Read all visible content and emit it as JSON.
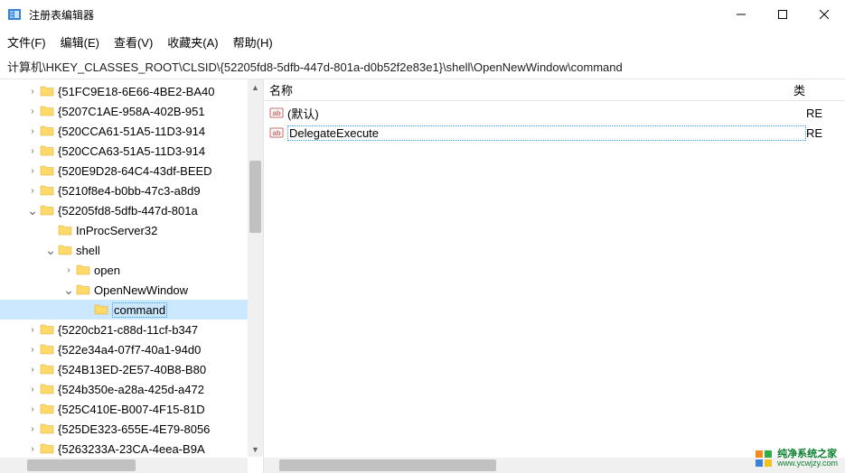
{
  "window": {
    "title": "注册表编辑器"
  },
  "menu": {
    "file": "文件(F)",
    "edit": "编辑(E)",
    "view": "查看(V)",
    "favorites": "收藏夹(A)",
    "help": "帮助(H)"
  },
  "address": "计算机\\HKEY_CLASSES_ROOT\\CLSID\\{52205fd8-5dfb-447d-801a-d0b52f2e83e1}\\shell\\OpenNewWindow\\command",
  "tree": [
    {
      "indent": 1,
      "chev": ">",
      "label": "{51FC9E18-6E66-4BE2-BA40"
    },
    {
      "indent": 1,
      "chev": ">",
      "label": "{5207C1AE-958A-402B-951"
    },
    {
      "indent": 1,
      "chev": ">",
      "label": "{520CCA61-51A5-11D3-914"
    },
    {
      "indent": 1,
      "chev": ">",
      "label": "{520CCA63-51A5-11D3-914"
    },
    {
      "indent": 1,
      "chev": ">",
      "label": "{520E9D28-64C4-43df-BEED"
    },
    {
      "indent": 1,
      "chev": ">",
      "label": "{5210f8e4-b0bb-47c3-a8d9"
    },
    {
      "indent": 1,
      "chev": "v",
      "label": "{52205fd8-5dfb-447d-801a"
    },
    {
      "indent": 2,
      "chev": "",
      "label": "InProcServer32"
    },
    {
      "indent": 2,
      "chev": "v",
      "label": "shell"
    },
    {
      "indent": 3,
      "chev": ">",
      "label": "open"
    },
    {
      "indent": 3,
      "chev": "v",
      "label": "OpenNewWindow"
    },
    {
      "indent": 4,
      "chev": "",
      "label": "command",
      "selected": true
    },
    {
      "indent": 1,
      "chev": ">",
      "label": "{5220cb21-c88d-11cf-b347"
    },
    {
      "indent": 1,
      "chev": ">",
      "label": "{522e34a4-07f7-40a1-94d0"
    },
    {
      "indent": 1,
      "chev": ">",
      "label": "{524B13ED-2E57-40B8-B80"
    },
    {
      "indent": 1,
      "chev": ">",
      "label": "{524b350e-a28a-425d-a472"
    },
    {
      "indent": 1,
      "chev": ">",
      "label": "{525C410E-B007-4F15-81D"
    },
    {
      "indent": 1,
      "chev": ">",
      "label": "{525DE323-655E-4E79-8056"
    },
    {
      "indent": 1,
      "chev": ">",
      "label": "{5263233A-23CA-4eea-B9A"
    }
  ],
  "list": {
    "columns": {
      "name": "名称",
      "type": "类"
    },
    "rows": [
      {
        "name": "(默认)",
        "type": "RE",
        "focused": false
      },
      {
        "name": "DelegateExecute",
        "type": "RE",
        "focused": true
      }
    ]
  },
  "watermark": {
    "line1": "纯净系统之家",
    "line2": "www.ycwjzy.com"
  }
}
